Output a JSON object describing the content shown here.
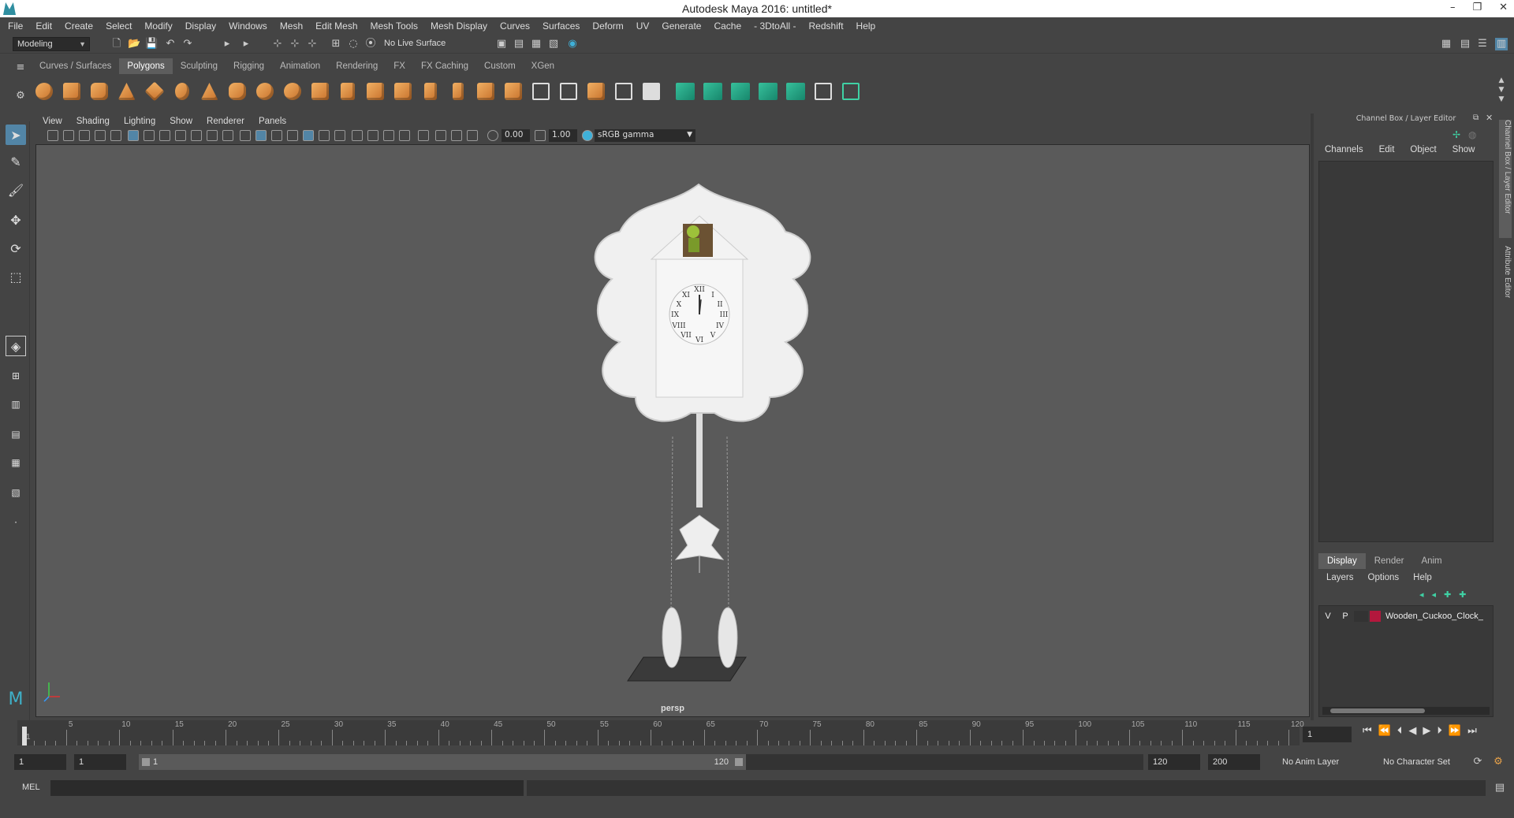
{
  "window": {
    "title": "Autodesk Maya 2016: untitled*",
    "controls": [
      "–",
      "❐",
      "✕"
    ]
  },
  "menubar": [
    "File",
    "Edit",
    "Create",
    "Select",
    "Modify",
    "Display",
    "Windows",
    "Mesh",
    "Edit Mesh",
    "Mesh Tools",
    "Mesh Display",
    "Curves",
    "Surfaces",
    "Deform",
    "UV",
    "Generate",
    "Cache",
    "- 3DtoAll -",
    "Redshift",
    "Help"
  ],
  "statusline": {
    "mode": "Modeling",
    "live_surface": "No Live Surface"
  },
  "shelf": {
    "tabs": [
      "Curves / Surfaces",
      "Polygons",
      "Sculpting",
      "Rigging",
      "Animation",
      "Rendering",
      "FX",
      "FX Caching",
      "Custom",
      "XGen"
    ],
    "active_tab": "Polygons"
  },
  "panel": {
    "menu": [
      "View",
      "Shading",
      "Lighting",
      "Show",
      "Renderer",
      "Panels"
    ],
    "exposure": "0.00",
    "gamma": "1.00",
    "color_space": "sRGB gamma",
    "camera_label": "persp"
  },
  "channel_box": {
    "header": "Channel Box / Layer Editor",
    "menu": [
      "Channels",
      "Edit",
      "Object",
      "Show"
    ],
    "side_tabs": [
      "Channel Box / Layer Editor",
      "Attribute Editor"
    ]
  },
  "layer_editor": {
    "tabs": [
      "Display",
      "Render",
      "Anim"
    ],
    "active_tab": "Display",
    "menu": [
      "Layers",
      "Options",
      "Help"
    ],
    "layers": [
      {
        "v": "V",
        "p": "P",
        "name": "Wooden_Cuckoo_Clock_",
        "color": "#b3183d"
      }
    ]
  },
  "timeline": {
    "ticks": [
      1,
      5,
      10,
      15,
      20,
      25,
      30,
      35,
      40,
      45,
      50,
      55,
      60,
      65,
      70,
      75,
      80,
      85,
      90,
      95,
      100,
      105,
      110,
      115,
      120
    ],
    "current_frame": "1"
  },
  "range": {
    "start": "1",
    "playback_start": "1",
    "slider_start": "1",
    "slider_end": "120",
    "playback_end": "120",
    "end": "200",
    "anim_layer": "No Anim Layer",
    "character_set": "No Character Set"
  },
  "commandline": {
    "label": "MEL"
  }
}
